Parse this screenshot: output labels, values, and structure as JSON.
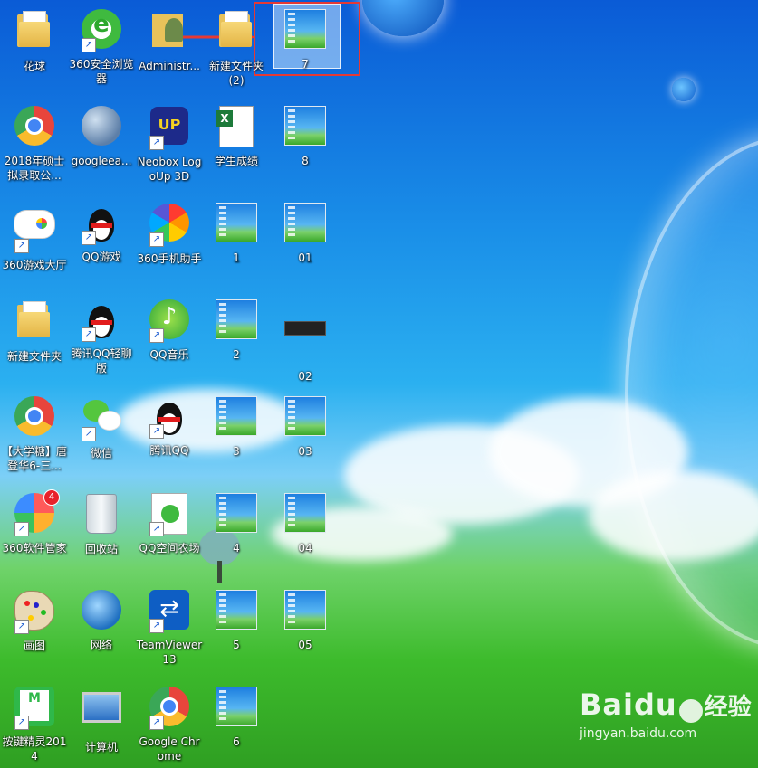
{
  "desktop": {
    "icons": {
      "huaqiu": "花球",
      "browser360": "360安全浏览器",
      "administrator": "Administr...",
      "new_folder_2": "新建文件夹 (2)",
      "img_7": "7",
      "chrome2018": "2018年硕士拟录取公...",
      "googleearth": "googleea...",
      "neobox": "Neobox LogoUp 3D",
      "student_scores": "学生成绩",
      "img_8": "8",
      "game_hall": "360游戏大厅",
      "qq_game": "QQ游戏",
      "phone_helper": "360手机助手",
      "img_1": "1",
      "img_01": "01",
      "new_folder": "新建文件夹",
      "qq_light": "腾讯QQ轻聊版",
      "qq_music": "QQ音乐",
      "img_2": "2",
      "img_02": "02",
      "chrome_tang": "【大学糖】唐登华6-三...",
      "wechat": "微信",
      "tencent_qq": "腾讯QQ",
      "img_3": "3",
      "img_03": "03",
      "soft_manager": "360软件管家",
      "soft_manager_badge": "4",
      "recycle_bin": "回收站",
      "qq_farm": "QQ空间农场",
      "img_4": "4",
      "img_04": "04",
      "paint": "画图",
      "network": "网络",
      "teamviewer": "TeamViewer 13",
      "img_5": "5",
      "img_05": "05",
      "key_elf": "按键精灵2014",
      "computer": "计算机",
      "google_chrome": "Google Chrome",
      "img_6": "6"
    }
  },
  "watermark": {
    "brand": "Baidu",
    "jingyan": "经验",
    "url": "jingyan.baidu.com"
  },
  "colors": {
    "highlight_box": "#e53935",
    "label_text": "#ffffff"
  }
}
